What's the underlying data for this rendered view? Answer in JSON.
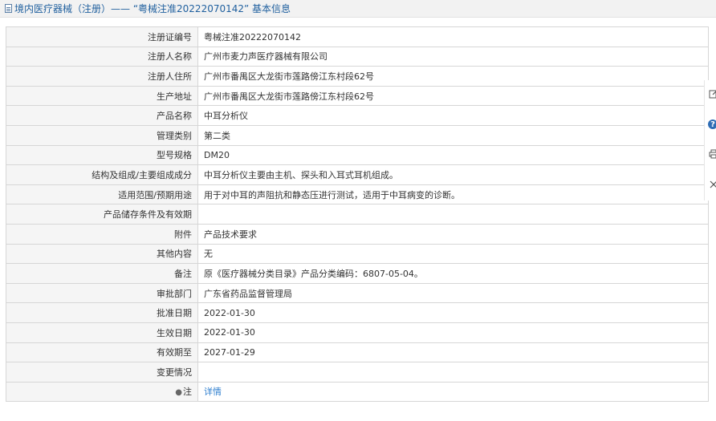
{
  "header": {
    "title": "境内医疗器械（注册）—— “粤械注准20222070142” 基本信息",
    "icon": "document-icon"
  },
  "rows": [
    {
      "label": "注册证编号",
      "value": "粤械注准20222070142"
    },
    {
      "label": "注册人名称",
      "value": "广州市麦力声医疗器械有限公司"
    },
    {
      "label": "注册人住所",
      "value": "广州市番禺区大龙街市莲路傍江东村段62号"
    },
    {
      "label": "生产地址",
      "value": "广州市番禺区大龙街市莲路傍江东村段62号"
    },
    {
      "label": "产品名称",
      "value": "中耳分析仪"
    },
    {
      "label": "管理类别",
      "value": "第二类"
    },
    {
      "label": "型号规格",
      "value": "DM20"
    },
    {
      "label": "结构及组成/主要组成成分",
      "value": "中耳分析仪主要由主机、探头和入耳式耳机组成。"
    },
    {
      "label": "适用范围/预期用途",
      "value": "用于对中耳的声阻抗和静态压进行测试，适用于中耳病变的诊断。"
    },
    {
      "label": "产品储存条件及有效期",
      "value": ""
    },
    {
      "label": "附件",
      "value": "产品技术要求"
    },
    {
      "label": "其他内容",
      "value": "无"
    },
    {
      "label": "备注",
      "value": "原《医疗器械分类目录》产品分类编码：6807-05-04。"
    },
    {
      "label": "审批部门",
      "value": "广东省药品监督管理局"
    },
    {
      "label": "批准日期",
      "value": "2022-01-30"
    },
    {
      "label": "生效日期",
      "value": "2022-01-30"
    },
    {
      "label": "有效期至",
      "value": "2027-01-29"
    },
    {
      "label": "变更情况",
      "value": ""
    }
  ],
  "note_row": {
    "label": "注",
    "link": "详情",
    "icon": "pin-icon"
  },
  "side_toolbar": {
    "icons": [
      "edit-icon",
      "help-icon",
      "print-icon",
      "close-icon"
    ]
  },
  "colors": {
    "header_text": "#1f5f9e",
    "link": "#2f7fcf",
    "label_bg": "#f5f5f5",
    "border": "#d6d6d6"
  }
}
